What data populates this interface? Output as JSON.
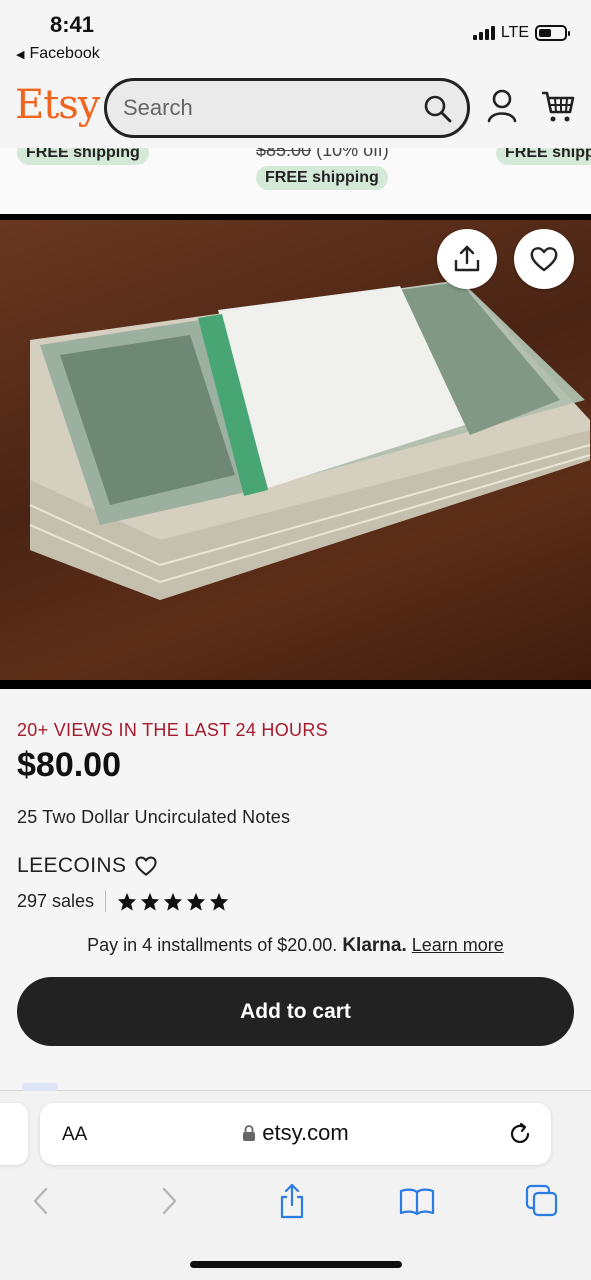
{
  "status": {
    "time": "8:41",
    "back_app": "Facebook",
    "network": "LTE"
  },
  "header": {
    "logo": "Etsy",
    "search_placeholder": "Search"
  },
  "carousel": {
    "left_pill": "FREE shipping",
    "center_old_price": "$85.00",
    "center_discount": "(10% off)",
    "center_pill": "FREE shipping",
    "right_pill": "FREE shipping"
  },
  "listing": {
    "views": "20+ VIEWS IN THE LAST 24 HOURS",
    "price": "$80.00",
    "title": "25 Two Dollar Uncirculated Notes",
    "shop_name": "LEECOINS",
    "sales": "297 sales",
    "rating_stars": 5,
    "klarna_text": "Pay in 4 installments of $20.00.",
    "klarna_brand": "Klarna.",
    "learn_more": "Learn more",
    "add_to_cart": "Add to cart"
  },
  "browser": {
    "text_size_label": "AA",
    "url": "etsy.com"
  },
  "icons": [
    "search-icon",
    "account-icon",
    "cart-icon",
    "share-icon",
    "heart-icon",
    "lock-icon",
    "reload-icon",
    "back-icon",
    "forward-icon",
    "bookmarks-icon",
    "tabs-icon"
  ]
}
